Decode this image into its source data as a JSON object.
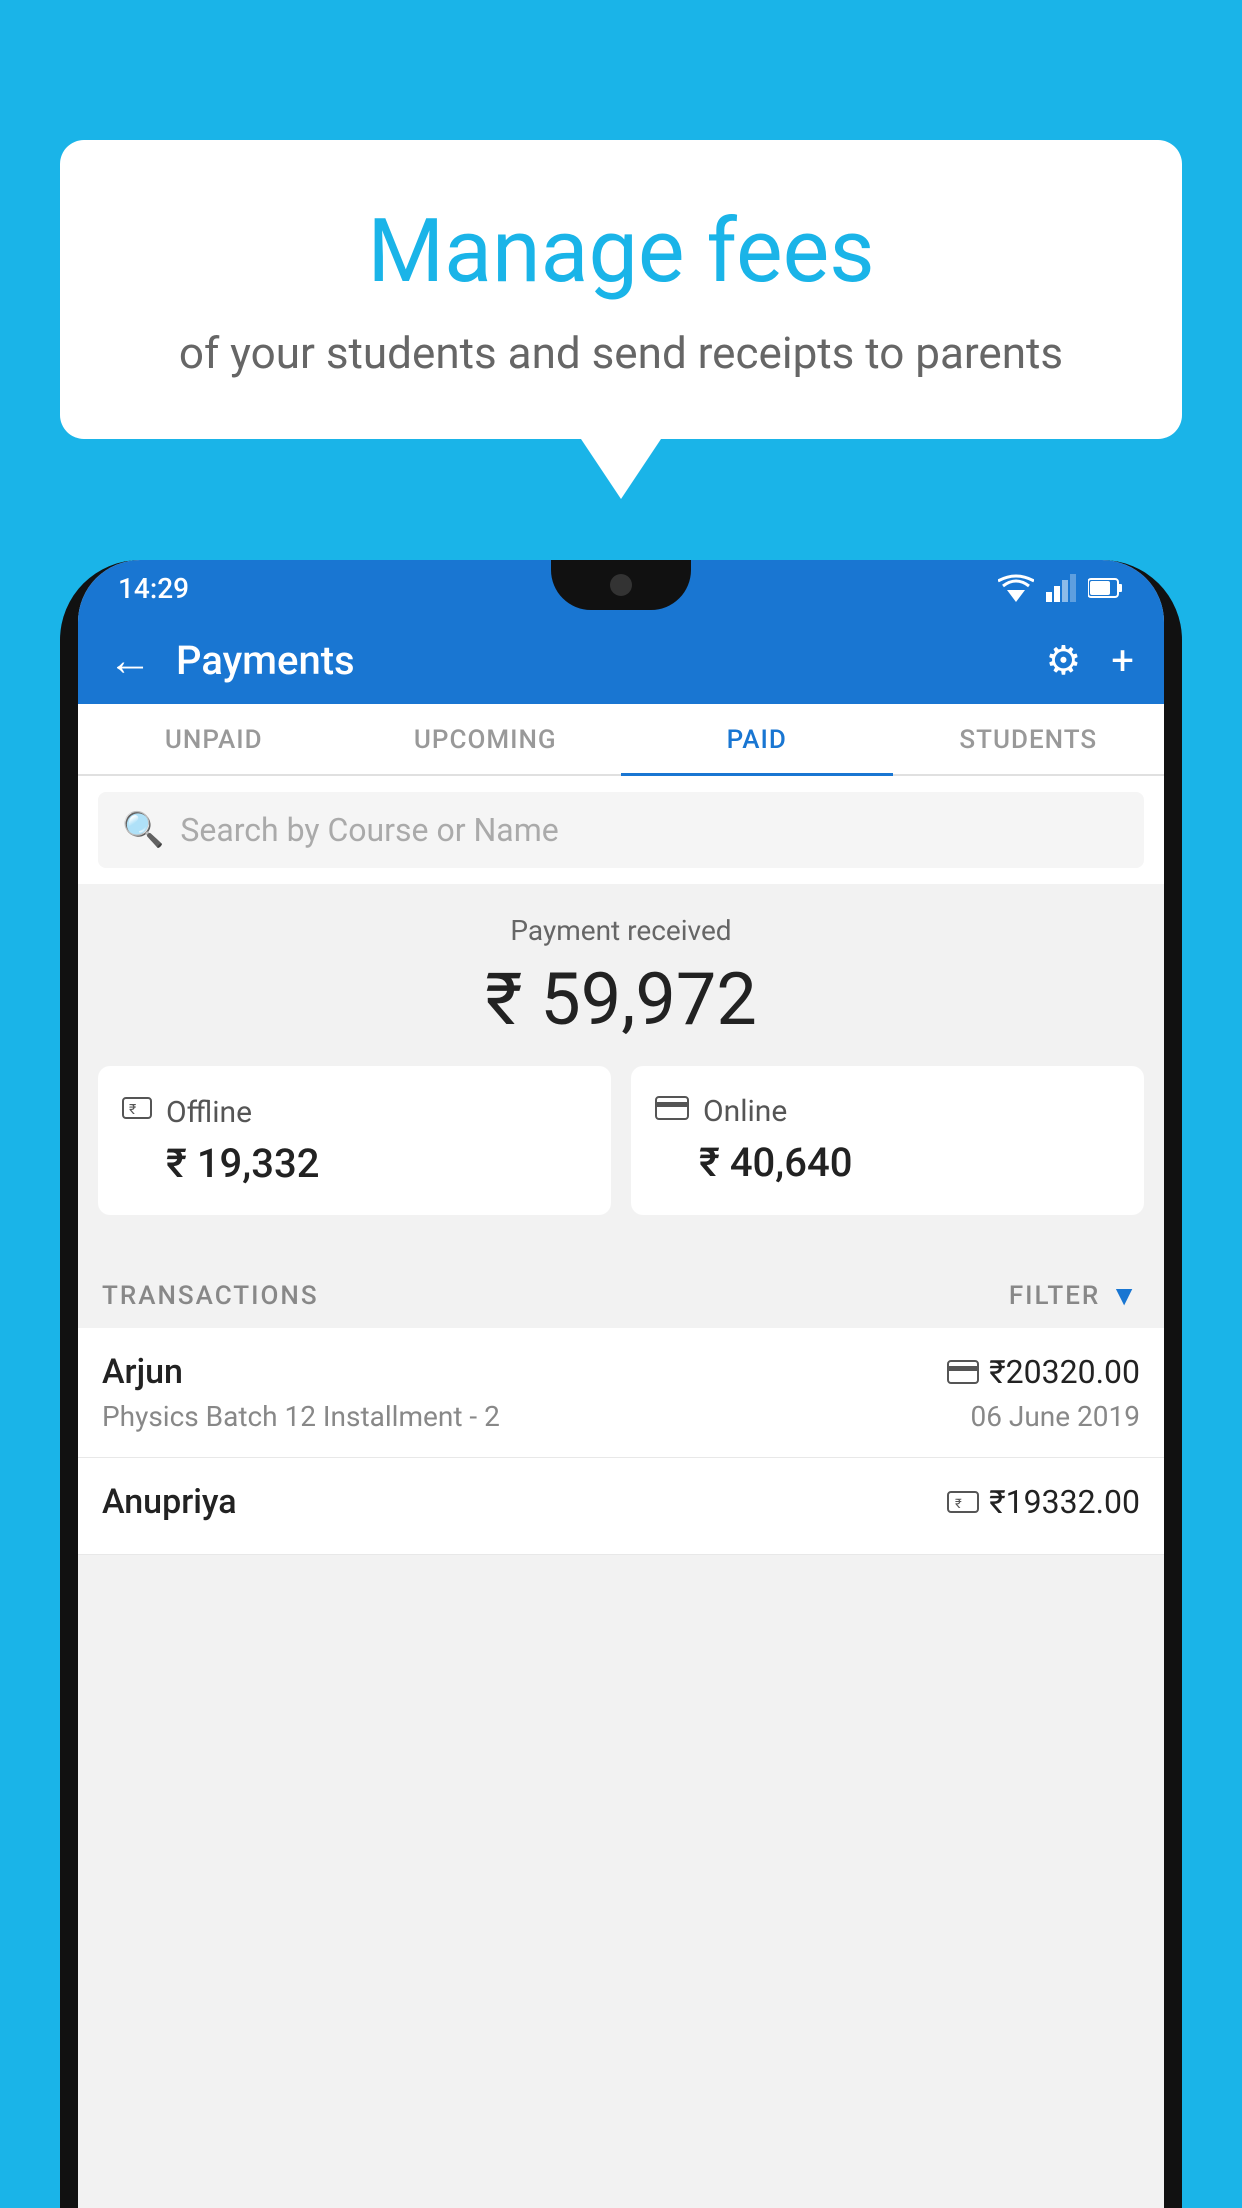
{
  "background_color": "#1ab4e8",
  "speech_bubble": {
    "title": "Manage fees",
    "subtitle": "of your students and send receipts to parents"
  },
  "status_bar": {
    "time": "14:29"
  },
  "app_bar": {
    "title": "Payments",
    "back_label": "←",
    "settings_label": "⚙",
    "add_label": "+"
  },
  "tabs": [
    {
      "label": "UNPAID",
      "active": false
    },
    {
      "label": "UPCOMING",
      "active": false
    },
    {
      "label": "PAID",
      "active": true
    },
    {
      "label": "STUDENTS",
      "active": false
    }
  ],
  "search": {
    "placeholder": "Search by Course or Name"
  },
  "payment_summary": {
    "label": "Payment received",
    "amount": "₹ 59,972",
    "offline": {
      "label": "Offline",
      "amount": "₹ 19,332"
    },
    "online": {
      "label": "Online",
      "amount": "₹ 40,640"
    }
  },
  "transactions": {
    "header_label": "TRANSACTIONS",
    "filter_label": "FILTER",
    "rows": [
      {
        "name": "Arjun",
        "course": "Physics Batch 12 Installment - 2",
        "amount": "₹20320.00",
        "date": "06 June 2019",
        "mode": "online"
      },
      {
        "name": "Anupriya",
        "course": "",
        "amount": "₹19332.00",
        "date": "",
        "mode": "offline"
      }
    ]
  }
}
